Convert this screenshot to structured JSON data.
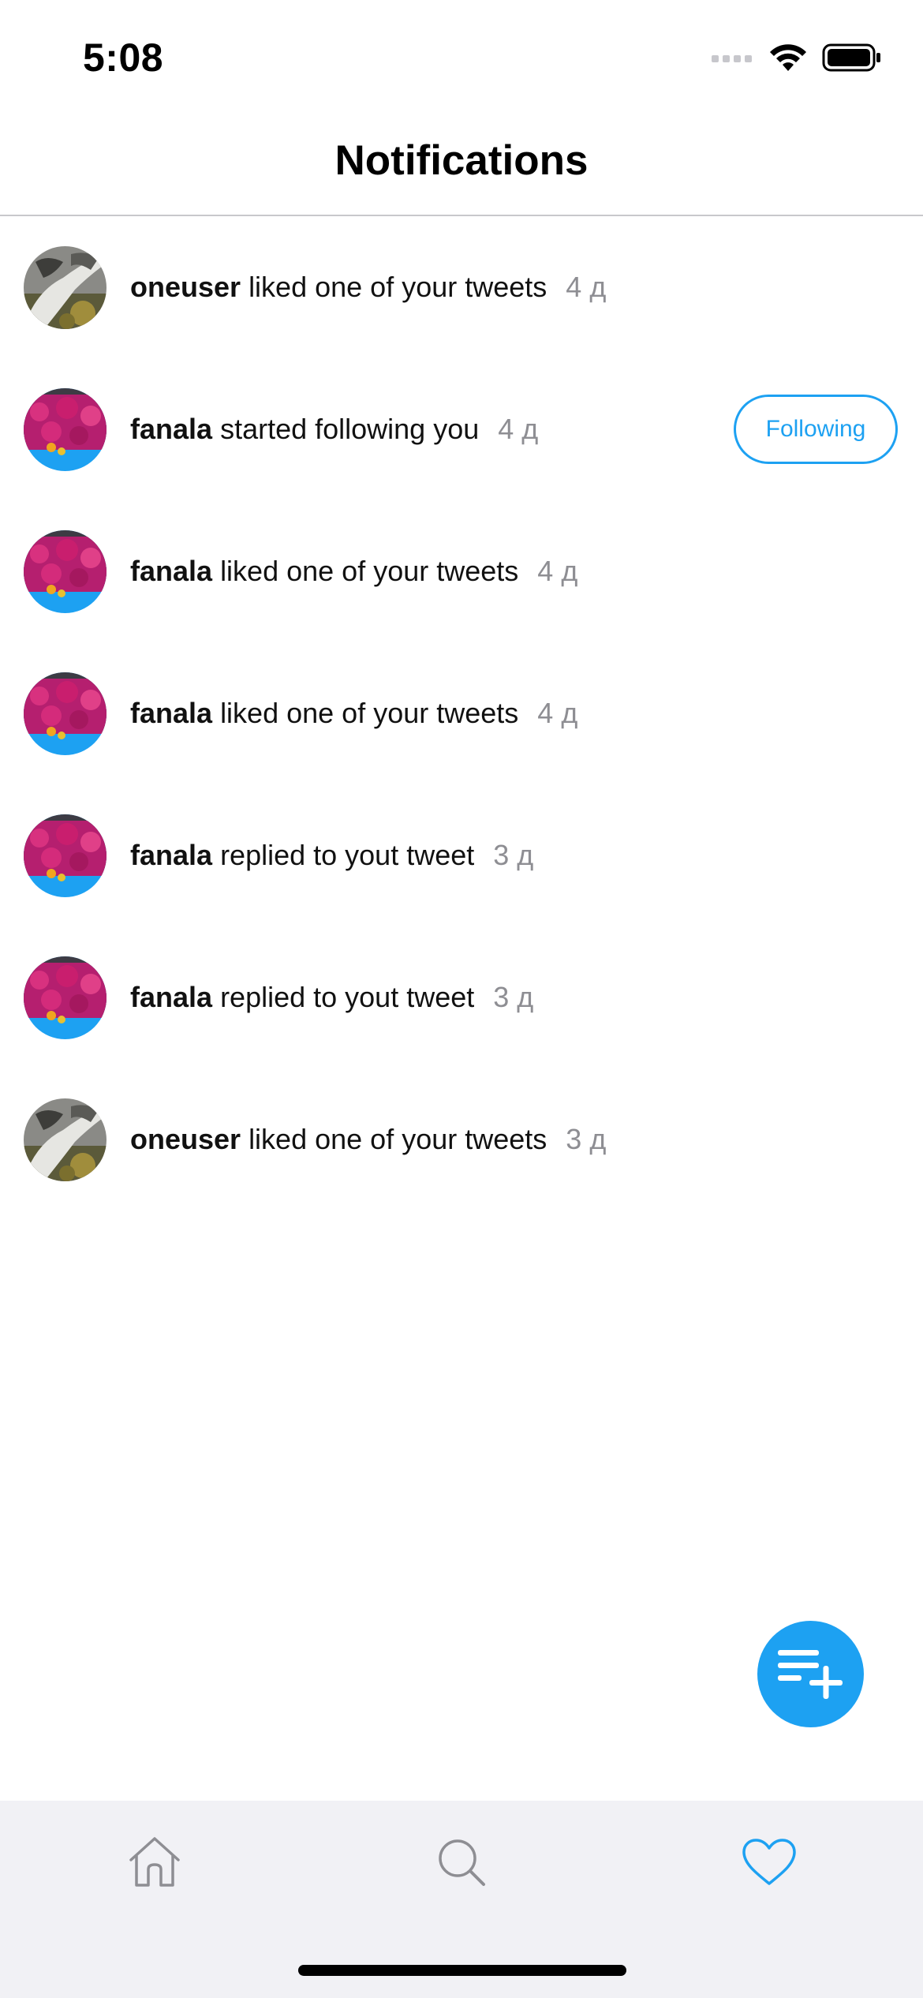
{
  "status_bar": {
    "time": "5:08"
  },
  "header": {
    "title": "Notifications"
  },
  "notifications": [
    {
      "user": "oneuser",
      "action": "liked one of your tweets",
      "time": "4 д",
      "avatar": "grayscale-hand-photo"
    },
    {
      "user": "fanala",
      "action": "started following you",
      "time": "4 д",
      "avatar": "pink-flowers-photo",
      "button": "Following"
    },
    {
      "user": "fanala",
      "action": "liked one of your tweets",
      "time": "4 д",
      "avatar": "pink-flowers-photo"
    },
    {
      "user": "fanala",
      "action": "liked one of your tweets",
      "time": "4 д",
      "avatar": "pink-flowers-photo"
    },
    {
      "user": "fanala",
      "action": "replied to yout tweet",
      "time": "3 д",
      "avatar": "pink-flowers-photo"
    },
    {
      "user": "fanala",
      "action": "replied to yout tweet",
      "time": "3 д",
      "avatar": "pink-flowers-photo"
    },
    {
      "user": "oneuser",
      "action": "liked one of your tweets",
      "time": "3 д",
      "avatar": "grayscale-hand-photo"
    }
  ],
  "fab": {
    "icon": "compose-list-plus-icon"
  },
  "tab_bar": {
    "tabs": [
      {
        "name": "home",
        "icon": "home-icon",
        "active": false
      },
      {
        "name": "search",
        "icon": "search-icon",
        "active": false
      },
      {
        "name": "notifications",
        "icon": "heart-icon",
        "active": true
      }
    ]
  },
  "colors": {
    "accent": "#1da1f2",
    "secondary_text": "#8e8e93",
    "tab_inactive": "#8e8e93",
    "tab_bar_bg": "#f1f1f5",
    "divider": "#c8c8cc"
  }
}
